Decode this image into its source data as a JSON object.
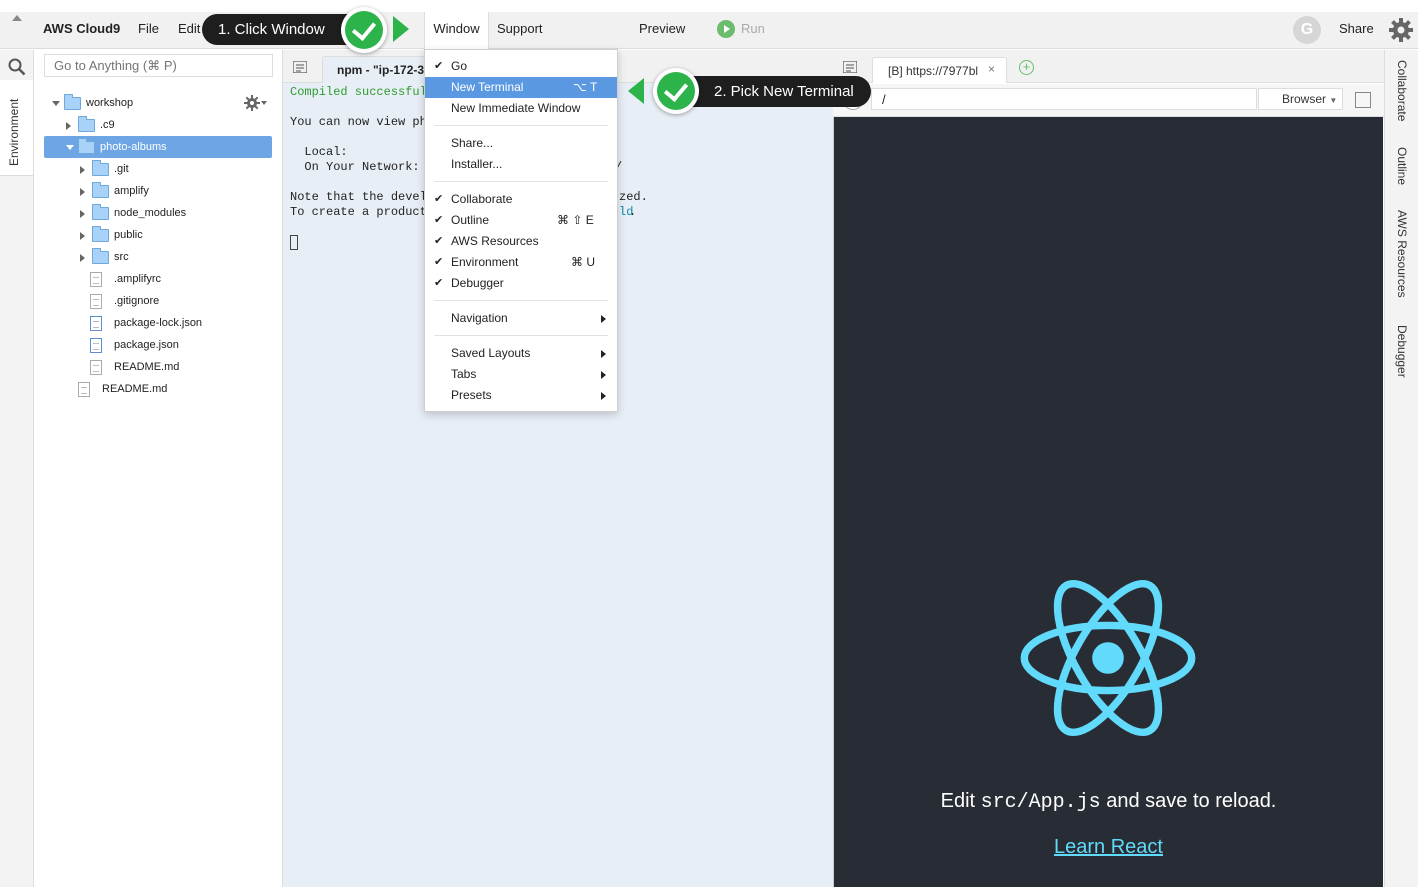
{
  "menubar": {
    "app_name": "AWS Cloud9",
    "items": [
      "File",
      "Edit",
      "Window",
      "Support",
      "Preview",
      "Run",
      "Share"
    ],
    "avatar_letter": "G"
  },
  "left_strip": {
    "tab_label": "Environment"
  },
  "sidebar": {
    "search_placeholder": "Go to Anything (⌘ P)",
    "tree": [
      {
        "label": "workshop",
        "type": "folder",
        "state": "expanded"
      },
      {
        "label": ".c9",
        "type": "folder",
        "state": "collapsed"
      },
      {
        "label": "photo-albums",
        "type": "folder",
        "state": "expanded",
        "selected": true
      },
      {
        "label": ".git",
        "type": "folder",
        "state": "collapsed"
      },
      {
        "label": "amplify",
        "type": "folder",
        "state": "collapsed"
      },
      {
        "label": "node_modules",
        "type": "folder",
        "state": "collapsed"
      },
      {
        "label": "public",
        "type": "folder",
        "state": "collapsed"
      },
      {
        "label": "src",
        "type": "folder",
        "state": "collapsed"
      },
      {
        "label": ".amplifyrc",
        "type": "file"
      },
      {
        "label": ".gitignore",
        "type": "file"
      },
      {
        "label": "package-lock.json",
        "type": "code"
      },
      {
        "label": "package.json",
        "type": "code"
      },
      {
        "label": "README.md",
        "type": "file"
      },
      {
        "label": "README.md",
        "type": "file"
      }
    ]
  },
  "editor": {
    "tab_label": "npm - \"ip-172-3",
    "lines": {
      "compiled": "Compiled successful",
      "view": "You can now view ph",
      "local": "  Local:",
      "network": "  On Your Network:",
      "network_tail": "/",
      "note": "Note that the devel",
      "note_tail": "zed.",
      "create": "To create a product",
      "create_tail": "ld",
      "create_end": "."
    }
  },
  "window_menu": {
    "items": [
      {
        "label": "Go",
        "checked": true
      },
      {
        "label": "New Terminal",
        "shortcut": "⌥ T",
        "highlighted": true
      },
      {
        "label": "New Immediate Window"
      },
      {
        "label": "Share..."
      },
      {
        "label": "Installer..."
      },
      {
        "label": "Collaborate",
        "checked": true
      },
      {
        "label": "Outline",
        "checked": true,
        "shortcut": "⌘ ⇧ E"
      },
      {
        "label": "AWS Resources",
        "checked": true
      },
      {
        "label": "Environment",
        "checked": true,
        "shortcut": "⌘ U"
      },
      {
        "label": "Debugger",
        "checked": true
      },
      {
        "label": "Navigation",
        "submenu": true
      },
      {
        "label": "Saved Layouts",
        "submenu": true
      },
      {
        "label": "Tabs",
        "submenu": true
      },
      {
        "label": "Presets",
        "submenu": true
      }
    ]
  },
  "browser": {
    "tab_label": "[B] https://7977bl",
    "url": "/",
    "mode": "Browser",
    "app": {
      "edit_prefix": "Edit",
      "edit_code": "src/App.js",
      "edit_suffix": "and save to reload.",
      "link": "Learn React"
    }
  },
  "right_strip": {
    "tabs": [
      "Collaborate",
      "Outline",
      "AWS Resources",
      "Debugger"
    ]
  },
  "callouts": {
    "step1": "1. Click Window",
    "step2": "2. Pick New Terminal"
  },
  "colors": {
    "accent_green": "#2cb34a",
    "menu_highlight": "#5a98e1",
    "react_blue": "#61dafb",
    "preview_bg": "#282c34"
  }
}
